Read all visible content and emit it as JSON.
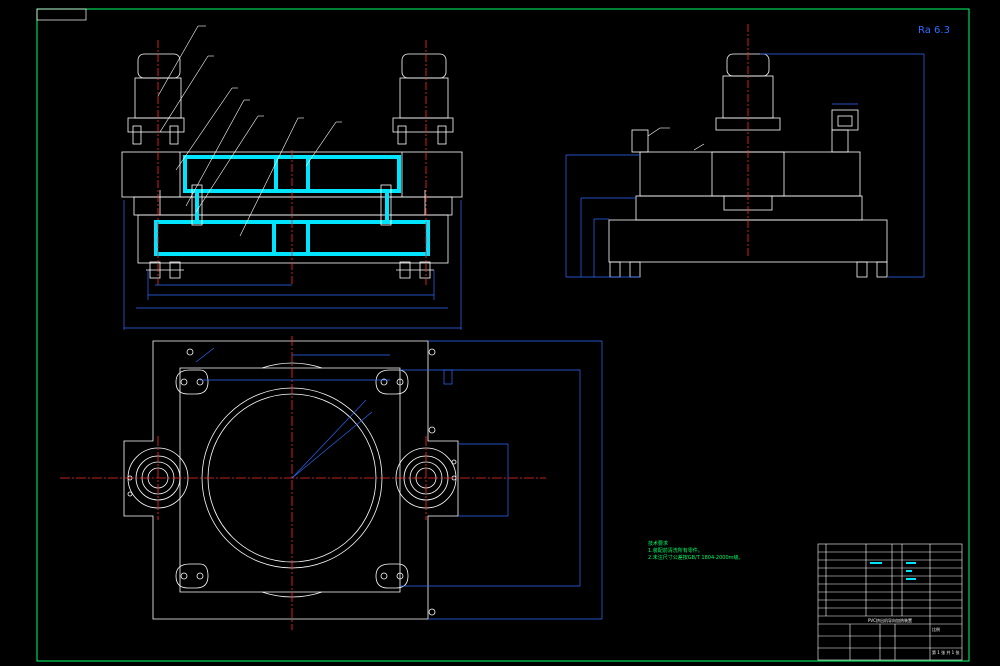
{
  "drawing": {
    "colors": {
      "background": "#000000",
      "frame": "#00ff66",
      "outline": "#ffffff",
      "section_fill": "#00e5ff",
      "dimension": "#2e6bff",
      "centerline": "#ff2a2a",
      "leader": "#ffffff"
    },
    "roughness_symbol": "Ra 6.3",
    "tech_notes": {
      "title": "技术要求",
      "lines": [
        "1.装配前清洗所有零件。",
        "2.未注尺寸公差按GB/T 1804-2000m级。"
      ]
    },
    "title_block": {
      "name_row": "PVC挤出机导向加热装置",
      "cells": [
        "",
        "",
        "",
        "",
        "",
        ""
      ],
      "scale_label": "比例",
      "sheet_label": "第 1 张 共 1 张"
    },
    "views": [
      "front-section-view",
      "side-view",
      "top-view"
    ]
  }
}
